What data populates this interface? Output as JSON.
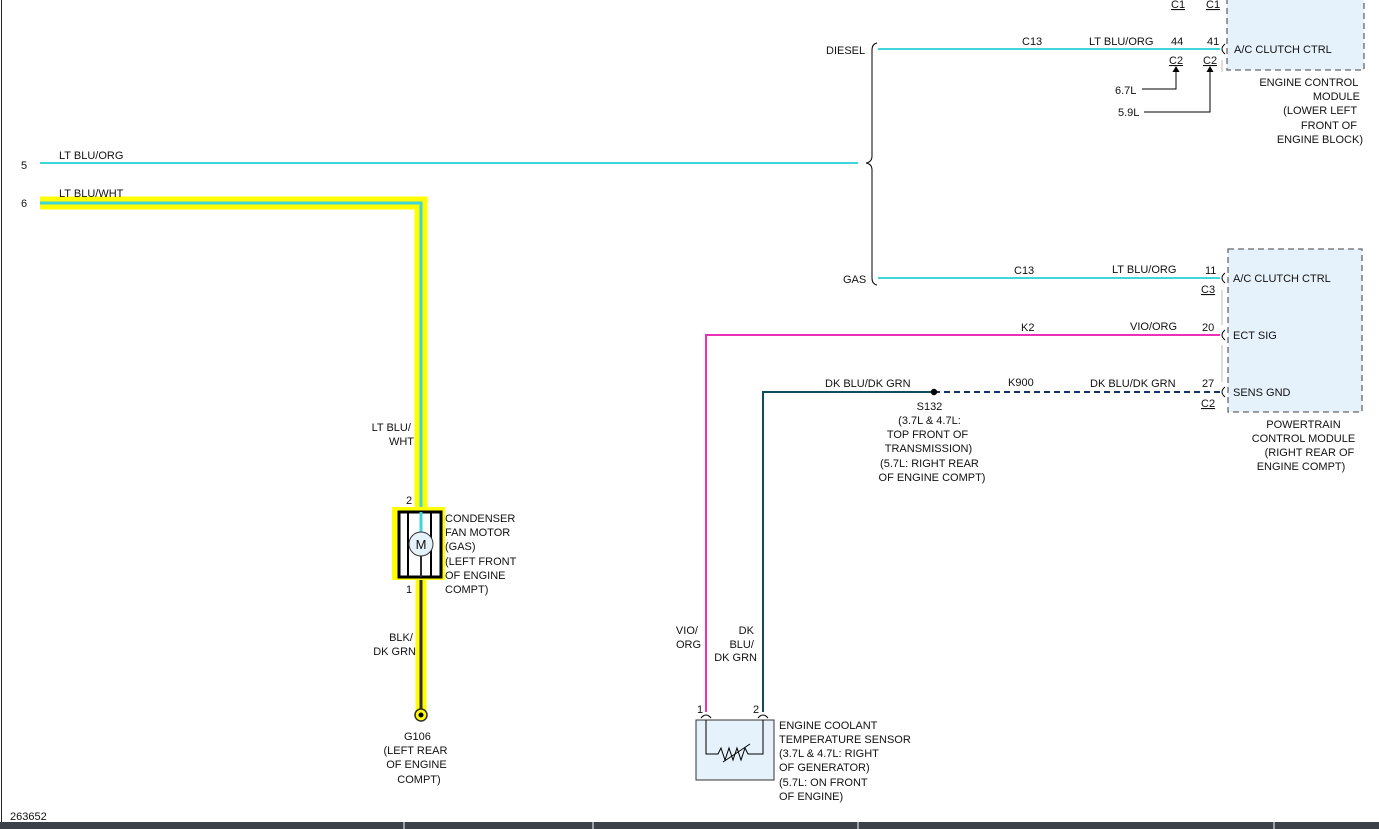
{
  "colors": {
    "cyan_wire": "#3fd6d9",
    "magenta_wire": "#ee2fb8",
    "dark_teal_wire": "#0f4c5c",
    "dk_blu_dashed": "#12336e",
    "highlight": "#ffff00",
    "blk_wire": "#332b2b",
    "module_fill": "#e6f2fb"
  },
  "connectors_top": {
    "c1_a": "C1",
    "c1_b": "C1"
  },
  "ecm": {
    "branch_diesel": "DIESEL",
    "wire_circuit": "C13",
    "wire_color": "LT BLU/ORG",
    "pin_44": "44",
    "pin_41": "41",
    "pin_label": "A/C CLUTCH CTRL",
    "conn_c2_a": "C2",
    "conn_c2_b": "C2",
    "engine_67": "6.7L",
    "engine_59": "5.9L",
    "title": [
      "ENGINE CONTROL",
      "MODULE",
      "(LOWER LEFT",
      "FRONT OF",
      "ENGINE BLOCK)"
    ]
  },
  "left_wires": {
    "w5_num": "5",
    "w5_color": "LT BLU/ORG",
    "w6_num": "6",
    "w6_color": "LT BLU/WHT"
  },
  "gas_branch": {
    "label": "GAS",
    "circuit": "C13",
    "color": "LT BLU/ORG",
    "pin": "11",
    "pin_label": "A/C CLUTCH CTRL",
    "conn": "C3"
  },
  "ect_sig": {
    "circuit": "K2",
    "color": "VIO/ORG",
    "pin": "20",
    "pin_label": "ECT SIG"
  },
  "sens_gnd": {
    "color_left": "DK BLU/DK GRN",
    "circuit": "K900",
    "color_right": "DK BLU/DK GRN",
    "pin": "27",
    "pin_label": "SENS GND",
    "conn": "C2"
  },
  "splice": {
    "lines": [
      "S132",
      "(3.7L & 4.7L:",
      "TOP FRONT OF",
      "TRANSMISSION)",
      "(5.7L: RIGHT REAR",
      "OF ENGINE COMPT)"
    ]
  },
  "pcm": {
    "title": [
      "POWERTRAIN",
      "CONTROL MODULE",
      "(RIGHT REAR OF",
      "ENGINE COMPT)"
    ]
  },
  "fan": {
    "wire_label": [
      "LT BLU/",
      "WHT"
    ],
    "pin_top": "2",
    "pin_bottom": "1",
    "motor_symbol": "M",
    "title": [
      "CONDENSER",
      "FAN MOTOR",
      "(GAS)",
      "(LEFT FRONT",
      "OF ENGINE",
      "COMPT)"
    ],
    "ground_wire_label": [
      "BLK/",
      "DK GRN"
    ]
  },
  "ground": {
    "lines": [
      "G106",
      "(LEFT REAR",
      "OF ENGINE",
      "COMPT)"
    ]
  },
  "ect_sensor": {
    "vio_label": [
      "VIO/",
      "ORG"
    ],
    "dk_label": [
      "DK",
      "BLU/",
      "DK GRN"
    ],
    "pin_1": "1",
    "pin_2": "2",
    "title": [
      "ENGINE COOLANT",
      "TEMPERATURE SENSOR",
      "(3.7L & 4.7L: RIGHT",
      "OF GENERATOR)",
      "(5.7L: ON FRONT",
      "OF ENGINE)"
    ]
  },
  "figure_id": "263652"
}
